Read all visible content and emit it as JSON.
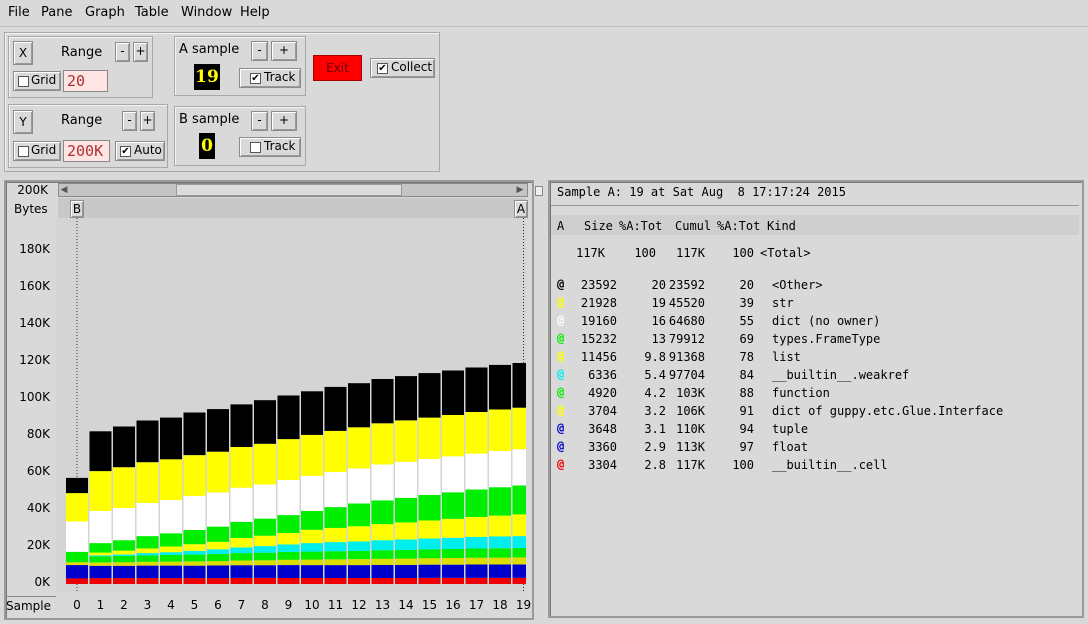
{
  "menu": {
    "file": "File",
    "pane": "Pane",
    "graph": "Graph",
    "table": "Table",
    "window": "Window",
    "help": "Help"
  },
  "xpanel": {
    "axis": "X",
    "range_label": "Range",
    "minus": "-",
    "plus": "+",
    "grid_label": "Grid",
    "grid_checked": false,
    "value": "20"
  },
  "ypanel": {
    "axis": "Y",
    "range_label": "Range",
    "minus": "-",
    "plus": "+",
    "grid_label": "Grid",
    "grid_checked": false,
    "value": "200K",
    "auto_label": "Auto",
    "auto_checked": true
  },
  "asample": {
    "label": "A sample",
    "minus": "-",
    "plus": "+",
    "value": "19",
    "track_label": "Track",
    "track_checked": true
  },
  "bsample": {
    "label": "B sample",
    "minus": "-",
    "plus": "+",
    "value": "0",
    "track_label": "Track",
    "track_checked": false
  },
  "exit_label": "Exit",
  "collect": {
    "label": "Collect",
    "checked": true
  },
  "graph": {
    "top_value": "200K",
    "unit": "Bytes",
    "marker_b": "B",
    "marker_a": "A",
    "sample_label": "Sample",
    "y_ticks": [
      "180K",
      "160K",
      "140K",
      "120K",
      "100K",
      "80K",
      "60K",
      "40K",
      "20K",
      "0K"
    ],
    "x_ticks": [
      "0",
      "1",
      "2",
      "3",
      "4",
      "5",
      "6",
      "7",
      "8",
      "9",
      "10",
      "11",
      "12",
      "13",
      "14",
      "15",
      "16",
      "17",
      "18",
      "19"
    ]
  },
  "chart_data": {
    "type": "bar",
    "stacked": true,
    "ylabel": "Bytes",
    "xlabel": "Sample",
    "ylim": [
      0,
      200000
    ],
    "categories": [
      "0",
      "1",
      "2",
      "3",
      "4",
      "5",
      "6",
      "7",
      "8",
      "9",
      "10",
      "11",
      "12",
      "13",
      "14",
      "15",
      "16",
      "17",
      "18",
      "19"
    ],
    "series": [
      {
        "color": "#ee0000",
        "values": [
          3000,
          3100,
          3100,
          3100,
          3100,
          3100,
          3100,
          3200,
          3200,
          3200,
          3200,
          3200,
          3200,
          3200,
          3200,
          3300,
          3300,
          3300,
          3300,
          3304
        ]
      },
      {
        "color": "#0000cc",
        "values": [
          7000,
          6500,
          6500,
          6600,
          6600,
          6600,
          6700,
          6700,
          6700,
          6800,
          6800,
          6800,
          6800,
          6900,
          6900,
          6900,
          6900,
          7000,
          7000,
          7008
        ]
      },
      {
        "color": "#dddd00",
        "values": [
          1500,
          1800,
          1900,
          2000,
          2100,
          2200,
          2300,
          2500,
          2600,
          2800,
          2900,
          3000,
          3100,
          3200,
          3300,
          3400,
          3500,
          3600,
          3650,
          3704
        ]
      },
      {
        "color": "#00ee00",
        "values": [
          3000,
          3200,
          3300,
          3400,
          3500,
          3600,
          3700,
          3900,
          4000,
          4100,
          4200,
          4300,
          4400,
          4500,
          4600,
          4700,
          4800,
          4850,
          4900,
          4920
        ]
      },
      {
        "color": "#00eeee",
        "values": [
          0,
          500,
          800,
          1200,
          1500,
          2000,
          2500,
          3000,
          3500,
          4000,
          4500,
          4800,
          5000,
          5300,
          5500,
          5700,
          5900,
          6100,
          6250,
          6336
        ]
      },
      {
        "color": "#ffff00",
        "values": [
          0,
          1500,
          2000,
          2500,
          3000,
          3500,
          4000,
          5000,
          5500,
          6000,
          7000,
          7500,
          8000,
          8500,
          9000,
          9500,
          10000,
          10500,
          11000,
          11456
        ]
      },
      {
        "color": "#00ee00",
        "values": [
          2500,
          5000,
          5500,
          6500,
          7000,
          7500,
          8000,
          8500,
          9000,
          9500,
          10000,
          11000,
          12000,
          12500,
          13000,
          13500,
          14000,
          14500,
          15000,
          15232
        ]
      },
      {
        "color": "#ffffff",
        "values": [
          16000,
          17000,
          17000,
          17500,
          17500,
          18000,
          18000,
          18000,
          18000,
          18500,
          18500,
          18500,
          18500,
          19000,
          19000,
          19000,
          19000,
          19000,
          19100,
          19160
        ]
      },
      {
        "color": "#ffff00",
        "values": [
          15000,
          21000,
          21500,
          21500,
          21500,
          21500,
          21500,
          21500,
          21500,
          21600,
          21600,
          21700,
          21700,
          21700,
          21800,
          21800,
          21800,
          21900,
          21900,
          21928
        ]
      },
      {
        "color": "#000000",
        "values": [
          8000,
          21000,
          21500,
          22000,
          22000,
          22500,
          22500,
          22500,
          23000,
          23000,
          23000,
          23200,
          23300,
          23400,
          23400,
          23500,
          23500,
          23500,
          23550,
          23592
        ]
      }
    ]
  },
  "table": {
    "header_line": "Sample A: 19 at Sat Aug  8 17:17:24 2015",
    "columns": [
      "A",
      "Size",
      "%A:Tot",
      "Cumul",
      "%A:Tot",
      "Kind"
    ],
    "total": {
      "size": "117K",
      "pct": "100",
      "cumul": "117K",
      "cpct": "100",
      "kind": "<Total>"
    },
    "rows": [
      {
        "marker": "@",
        "color": "#000000",
        "size": "23592",
        "pct": "20",
        "cumul": "23592",
        "cpct": "20",
        "kind": "<Other>"
      },
      {
        "marker": "@",
        "color": "#ffff00",
        "size": "21928",
        "pct": "19",
        "cumul": "45520",
        "cpct": "39",
        "kind": "str"
      },
      {
        "marker": "@",
        "color": "#ffffff",
        "size": "19160",
        "pct": "16",
        "cumul": "64680",
        "cpct": "55",
        "kind": "dict (no owner)"
      },
      {
        "marker": "@",
        "color": "#00ee00",
        "size": "15232",
        "pct": "13",
        "cumul": "79912",
        "cpct": "69",
        "kind": "types.FrameType"
      },
      {
        "marker": "@",
        "color": "#ffff00",
        "size": "11456",
        "pct": "9.8",
        "cumul": "91368",
        "cpct": "78",
        "kind": "list"
      },
      {
        "marker": "@",
        "color": "#00eeee",
        "size": "6336",
        "pct": "5.4",
        "cumul": "97704",
        "cpct": "84",
        "kind": "__builtin__.weakref"
      },
      {
        "marker": "@",
        "color": "#00ee00",
        "size": "4920",
        "pct": "4.2",
        "cumul": "103K",
        "cpct": "88",
        "kind": "function"
      },
      {
        "marker": "@",
        "color": "#ffff00",
        "size": "3704",
        "pct": "3.2",
        "cumul": "106K",
        "cpct": "91",
        "kind": "dict of guppy.etc.Glue.Interface"
      },
      {
        "marker": "@",
        "color": "#0000cc",
        "size": "3648",
        "pct": "3.1",
        "cumul": "110K",
        "cpct": "94",
        "kind": "tuple"
      },
      {
        "marker": "@",
        "color": "#0000cc",
        "size": "3360",
        "pct": "2.9",
        "cumul": "113K",
        "cpct": "97",
        "kind": "float"
      },
      {
        "marker": "@",
        "color": "#ee0000",
        "size": "3304",
        "pct": "2.8",
        "cumul": "117K",
        "cpct": "100",
        "kind": "__builtin__.cell"
      }
    ]
  }
}
